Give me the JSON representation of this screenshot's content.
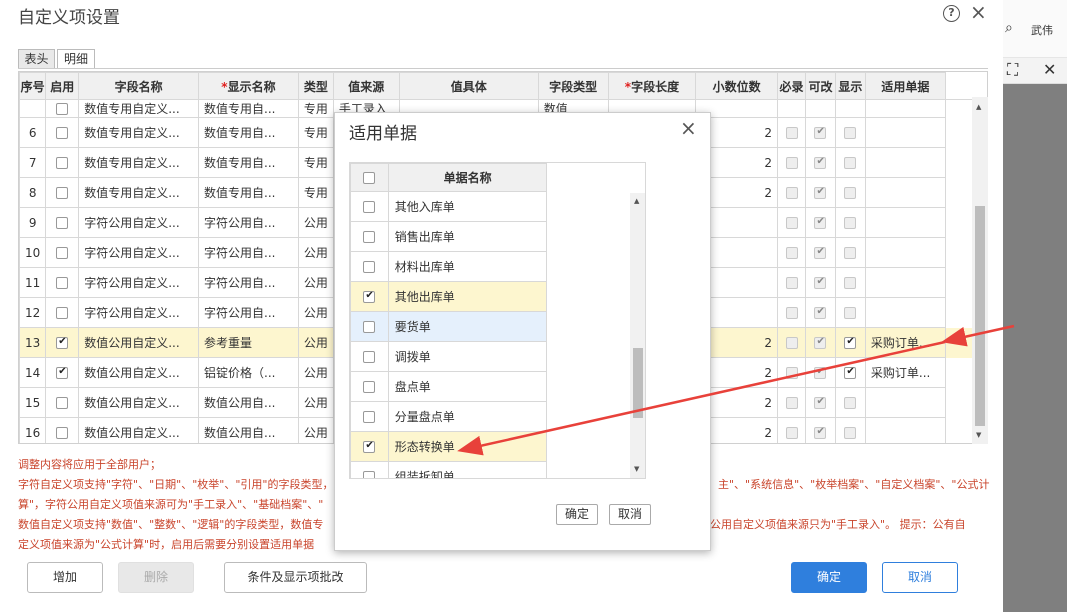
{
  "background_app": {
    "user_name": "武伟"
  },
  "dialog": {
    "title": "自定义项设置",
    "help_icon": "?",
    "close_icon": "×",
    "tabs": [
      {
        "label": "表头",
        "active": false
      },
      {
        "label": "明细",
        "active": true
      }
    ],
    "columns": [
      "序号",
      "启用",
      "字段名称",
      "显示名称",
      "类型",
      "值来源",
      "值具体",
      "字段类型",
      "字段长度",
      "小数位数",
      "必录",
      "可改",
      "显示",
      "适用单据"
    ],
    "required_marker": "*",
    "partial_row": {
      "seq": "",
      "field": "数值专用自定义...",
      "display": "数值专用自...",
      "type": "专用",
      "source": "手工录入",
      "field_type": "数值"
    },
    "rows": [
      {
        "seq": "6",
        "enabled": false,
        "field": "数值专用自定义...",
        "display": "数值专用自...",
        "type": "专用",
        "decimals": "2",
        "required": false,
        "editable": true,
        "show": false,
        "doc": ""
      },
      {
        "seq": "7",
        "enabled": false,
        "field": "数值专用自定义...",
        "display": "数值专用自...",
        "type": "专用",
        "decimals": "2",
        "required": false,
        "editable": true,
        "show": false,
        "doc": ""
      },
      {
        "seq": "8",
        "enabled": false,
        "field": "数值专用自定义...",
        "display": "数值专用自...",
        "type": "专用",
        "decimals": "2",
        "required": false,
        "editable": true,
        "show": false,
        "doc": ""
      },
      {
        "seq": "9",
        "enabled": false,
        "field": "字符公用自定义...",
        "display": "字符公用自...",
        "type": "公用",
        "decimals": "",
        "required": false,
        "editable": true,
        "show": false,
        "doc": ""
      },
      {
        "seq": "10",
        "enabled": false,
        "field": "字符公用自定义...",
        "display": "字符公用自...",
        "type": "公用",
        "decimals": "",
        "required": false,
        "editable": true,
        "show": false,
        "doc": ""
      },
      {
        "seq": "11",
        "enabled": false,
        "field": "字符公用自定义...",
        "display": "字符公用自...",
        "type": "公用",
        "decimals": "",
        "required": false,
        "editable": true,
        "show": false,
        "doc": ""
      },
      {
        "seq": "12",
        "enabled": false,
        "field": "字符公用自定义...",
        "display": "字符公用自...",
        "type": "公用",
        "decimals": "",
        "required": false,
        "editable": true,
        "show": false,
        "doc": ""
      },
      {
        "seq": "13",
        "enabled": true,
        "field": "数值公用自定义...",
        "display": "参考重量",
        "type": "公用",
        "decimals": "2",
        "required": false,
        "editable": true,
        "show": true,
        "doc": "采购订单...",
        "highlight": true
      },
      {
        "seq": "14",
        "enabled": true,
        "field": "数值公用自定义...",
        "display": "铝锭价格（...",
        "type": "公用",
        "decimals": "2",
        "required": false,
        "editable": true,
        "show": true,
        "doc": "采购订单..."
      },
      {
        "seq": "15",
        "enabled": false,
        "field": "数值公用自定义...",
        "display": "数值公用自...",
        "type": "公用",
        "decimals": "2",
        "required": false,
        "editable": true,
        "show": false,
        "doc": ""
      },
      {
        "seq": "16",
        "enabled": false,
        "field": "数值公用自定义...",
        "display": "数值公用自...",
        "type": "公用",
        "decimals": "2",
        "required": false,
        "editable": true,
        "show": false,
        "doc": ""
      }
    ],
    "notes": [
      "调整内容将应用于全部用户；",
      "字符自定义项支持\"字符\"、\"日期\"、\"枚举\"、\"引用\"的字段类型，字符",
      "算\"，字符公用自定义项值来源可为\"手工录入\"、\"基础档案\"、\"",
      "数值自定义项支持\"数值\"、\"整数\"、\"逻辑\"的字段类型，数值专",
      "定义项值来源为\"公式计算\"时，启用后需要分别设置适用单据"
    ],
    "notes_right": [
      "",
      "主\"、\"系统信息\"、\"枚举档案\"、\"自定义档案\"、\"公式计",
      "",
      "公用自定义项值来源只为\"手工录入\"。 提示：公有自",
      ""
    ],
    "buttons": {
      "add": "增加",
      "delete": "删除",
      "batch": "条件及显示项批改",
      "ok": "确定",
      "cancel": "取消"
    }
  },
  "modal": {
    "title": "适用单据",
    "close_icon": "×",
    "column": "单据名称",
    "items": [
      {
        "name": "其他入库单",
        "checked": false,
        "style": ""
      },
      {
        "name": "销售出库单",
        "checked": false,
        "style": ""
      },
      {
        "name": "材料出库单",
        "checked": false,
        "style": ""
      },
      {
        "name": "其他出库单",
        "checked": true,
        "style": "y"
      },
      {
        "name": "要货单",
        "checked": false,
        "style": "b"
      },
      {
        "name": "调拨单",
        "checked": false,
        "style": ""
      },
      {
        "name": "盘点单",
        "checked": false,
        "style": ""
      },
      {
        "name": "分量盘点单",
        "checked": false,
        "style": ""
      },
      {
        "name": "形态转换单",
        "checked": true,
        "style": "y"
      },
      {
        "name": "组装拆卸单",
        "checked": false,
        "style": ""
      }
    ],
    "buttons": {
      "ok": "确定",
      "cancel": "取消"
    }
  },
  "colors": {
    "accent": "#2f7fdd",
    "note_text": "#c9442b",
    "arrow": "#e8413a",
    "highlight_row": "#fdf6cf"
  }
}
